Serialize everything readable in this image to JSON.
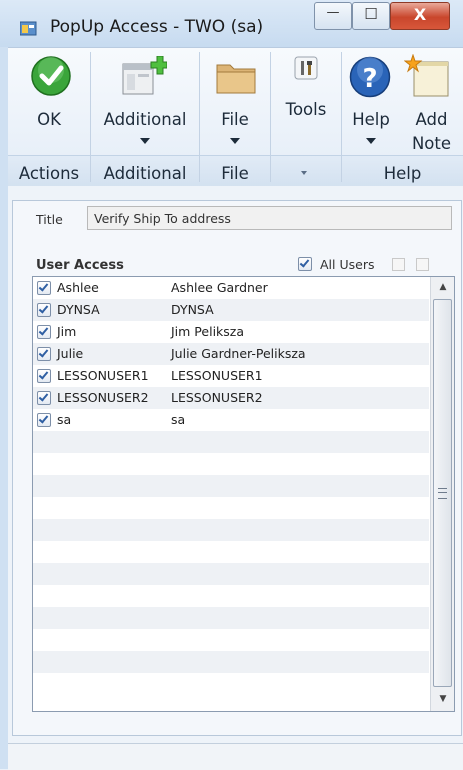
{
  "window": {
    "title": "PopUp Access  -  TWO (sa)",
    "controls": {
      "minimize": "—",
      "maximize": "☐",
      "close": "X"
    }
  },
  "ribbon": {
    "buttons": [
      {
        "label": "OK",
        "icon": "ok-checkmark-icon"
      },
      {
        "label": "Additional",
        "icon": "additional-window-icon"
      },
      {
        "label": "File",
        "icon": "file-folder-icon"
      },
      {
        "label": "Tools",
        "icon": "tools-icon"
      },
      {
        "label": "Help",
        "icon": "help-icon"
      },
      {
        "label_line1": "Add",
        "label_line2": "Note",
        "icon": "add-note-icon"
      }
    ],
    "groups": [
      "Actions",
      "Additional",
      "File",
      "Help"
    ]
  },
  "form": {
    "title_label": "Title",
    "title_value": "Verify Ship To address",
    "user_access_label": "User Access",
    "all_users_label": "All Users",
    "all_users_checked": true
  },
  "users": [
    {
      "id": "Ashlee",
      "name": "Ashlee Gardner",
      "checked": true
    },
    {
      "id": "DYNSA",
      "name": "DYNSA",
      "checked": true
    },
    {
      "id": "Jim",
      "name": "Jim Peliksza",
      "checked": true
    },
    {
      "id": "Julie",
      "name": "Julie Gardner-Peliksza",
      "checked": true
    },
    {
      "id": "LESSONUSER1",
      "name": "LESSONUSER1",
      "checked": true
    },
    {
      "id": "LESSONUSER2",
      "name": "LESSONUSER2",
      "checked": true
    },
    {
      "id": "sa",
      "name": "sa",
      "checked": true
    }
  ],
  "colors": {
    "accent": "#2f5fa3",
    "close": "#c9462c",
    "ok_green": "#3aa53a",
    "help_blue": "#2a64b8"
  }
}
